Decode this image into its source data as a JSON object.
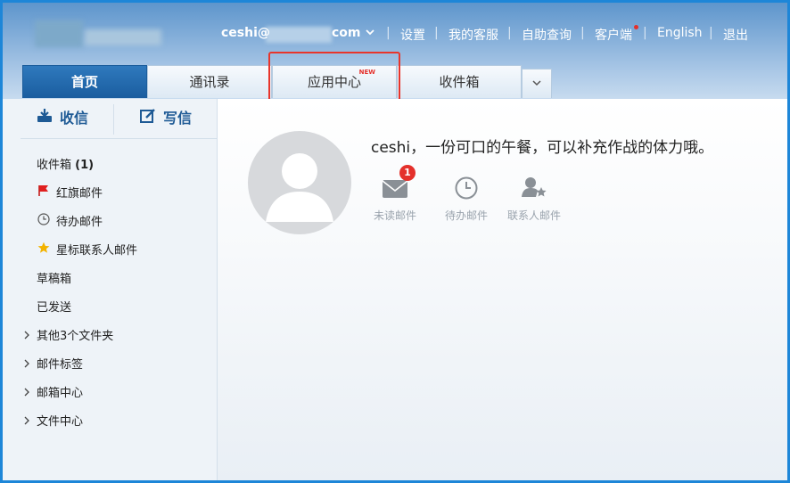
{
  "header": {
    "user_prefix": "ceshi@",
    "user_suffix": "com",
    "dropdown_icon": "chevron-down-icon",
    "links": [
      "设置",
      "我的客服",
      "自助查询",
      "客户端",
      "English",
      "退出"
    ]
  },
  "tabs": [
    {
      "label": "首页",
      "active": true
    },
    {
      "label": "通讯录"
    },
    {
      "label": "应用中心",
      "badge": "NEW"
    },
    {
      "label": "收件箱"
    }
  ],
  "tab_more_icon": "chevron-down-icon",
  "sidebar": {
    "receive_label": "收信",
    "write_label": "写信",
    "items": [
      {
        "label": "收件箱",
        "count": "(1)",
        "icon": ""
      },
      {
        "label": "红旗邮件",
        "icon": "red-flag-icon"
      },
      {
        "label": "待办邮件",
        "icon": "clock-icon"
      },
      {
        "label": "星标联系人邮件",
        "icon": "star-icon"
      },
      {
        "label": "草稿箱",
        "icon": ""
      },
      {
        "label": "已发送",
        "icon": ""
      },
      {
        "label": "其他3个文件夹",
        "icon": "chevron-right-icon"
      },
      {
        "label": "邮件标签",
        "icon": "chevron-right-icon"
      },
      {
        "label": "邮箱中心",
        "icon": "chevron-right-icon"
      },
      {
        "label": "文件中心",
        "icon": "chevron-right-icon"
      }
    ]
  },
  "main": {
    "greeting": "ceshi，一份可口的午餐，可以补充作战的体力哦。",
    "stats": [
      {
        "label": "未读邮件",
        "icon": "envelope-icon",
        "badge": "1"
      },
      {
        "label": "待办邮件",
        "icon": "clock-icon"
      },
      {
        "label": "联系人邮件",
        "icon": "contact-star-icon"
      }
    ]
  },
  "colors": {
    "accent": "#1a5d9f",
    "highlight": "#e8352b",
    "badge": "#e4302b"
  }
}
